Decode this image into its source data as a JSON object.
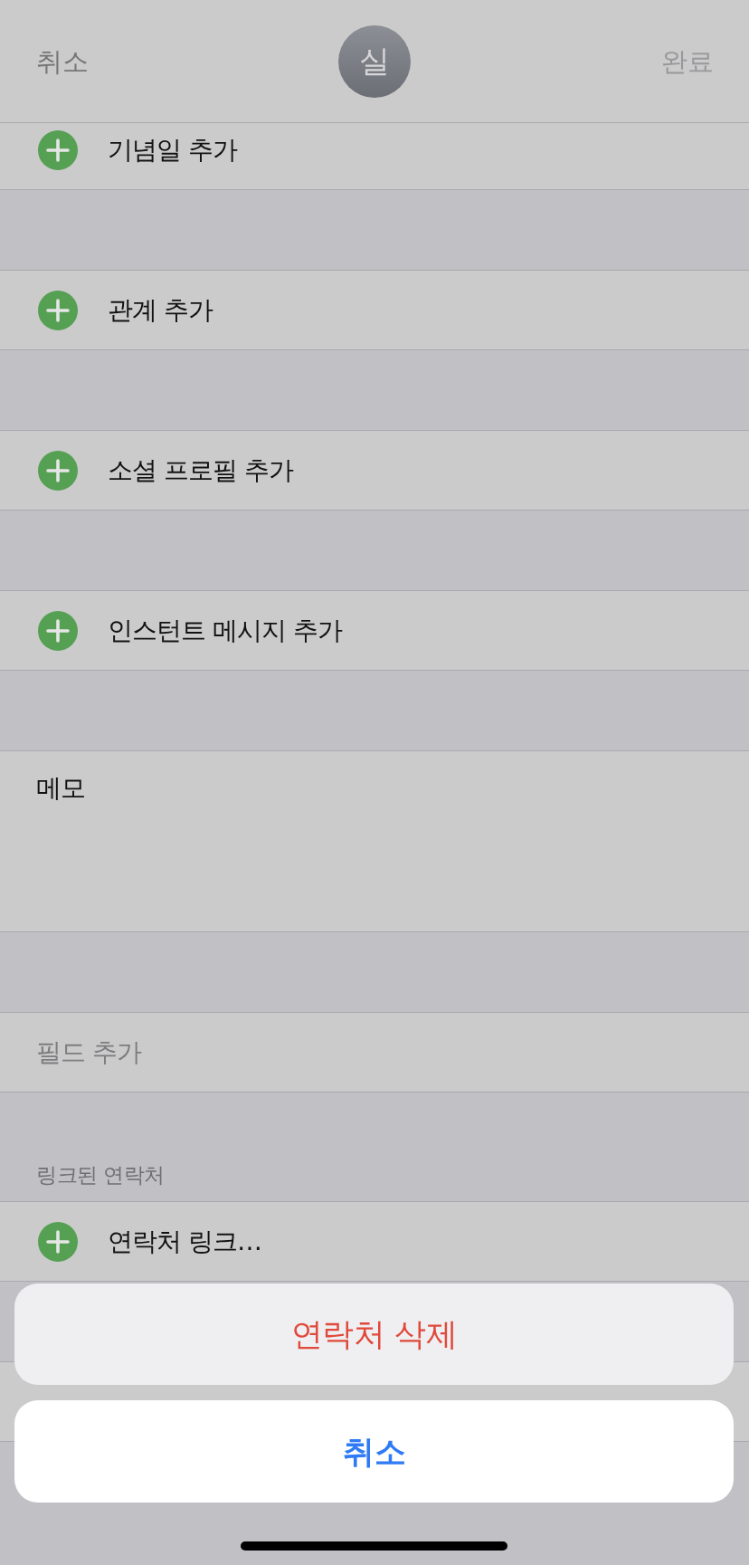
{
  "nav_bar": {
    "cancel": {
      "label": "취소",
      "disabled": false
    },
    "avatar": {
      "initial": "실"
    },
    "done": {
      "label": "완료",
      "disabled": true
    }
  },
  "sections": [
    {
      "rows": [
        {
          "kind": "add",
          "label": "기념일 추가"
        }
      ]
    },
    {
      "rows": [
        {
          "kind": "add",
          "label": "관계 추가"
        }
      ]
    },
    {
      "rows": [
        {
          "kind": "add",
          "label": "소셜 프로필 추가"
        }
      ]
    },
    {
      "rows": [
        {
          "kind": "add",
          "label": "인스턴트 메시지 추가"
        }
      ]
    },
    {
      "rows": [
        {
          "kind": "note",
          "label": "메모"
        }
      ]
    },
    {
      "rows": [
        {
          "kind": "field",
          "label": "필드 추가"
        }
      ]
    },
    {
      "header": "링크된 연락처",
      "rows": [
        {
          "kind": "add",
          "label": "연락처 링크…"
        }
      ]
    },
    {
      "rows": [
        {
          "kind": "covered"
        }
      ]
    }
  ],
  "action_sheet": {
    "actions": [
      {
        "kind": "destructive",
        "label": "연락처 삭제"
      }
    ],
    "cancel": {
      "label": "취소"
    }
  }
}
